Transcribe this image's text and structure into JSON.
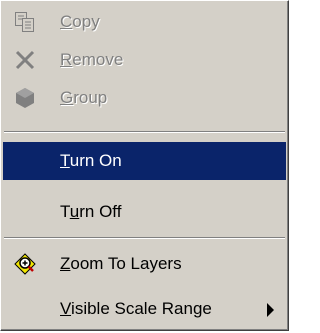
{
  "context_menu": {
    "items": [
      {
        "pre": "",
        "mn": "C",
        "post": "opy",
        "enabled": false
      },
      {
        "pre": "",
        "mn": "R",
        "post": "emove",
        "enabled": false
      },
      {
        "pre": "",
        "mn": "G",
        "post": "roup",
        "enabled": false
      },
      {
        "pre": "",
        "mn": "T",
        "post": "urn On",
        "enabled": true,
        "selected": true
      },
      {
        "pre": "T",
        "mn": "u",
        "post": "rn Off",
        "enabled": true
      },
      {
        "pre": "",
        "mn": "Z",
        "post": "oom To Layers",
        "enabled": true
      },
      {
        "pre": "",
        "mn": "V",
        "post": "isible Scale Range",
        "enabled": true,
        "has_submenu": true
      }
    ]
  },
  "colors": {
    "menu_background": "#d4d0c8",
    "selection_highlight": "#0a246a",
    "disabled_text": "#808080"
  },
  "icons": {
    "copy": "copy-icon",
    "remove": "remove-icon",
    "group": "group-icon",
    "zoom_to_layers": "zoom-to-layers-icon",
    "submenu": "submenu-arrow-icon"
  }
}
